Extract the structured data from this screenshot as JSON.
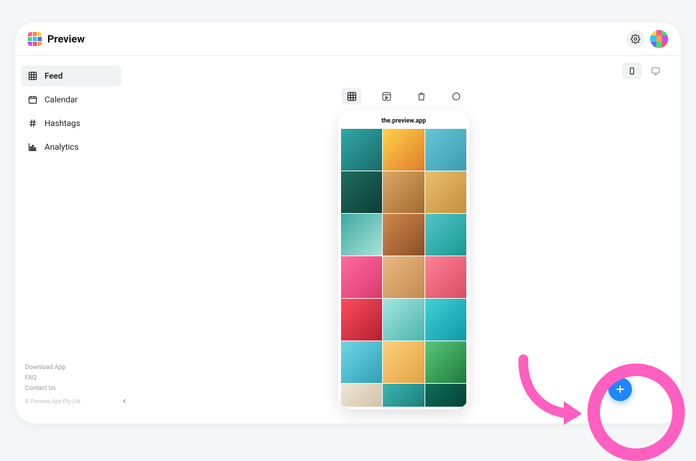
{
  "brand": {
    "title": "Preview"
  },
  "sidebar": {
    "items": [
      {
        "label": "Feed"
      },
      {
        "label": "Calendar"
      },
      {
        "label": "Hashtags"
      },
      {
        "label": "Analytics"
      }
    ],
    "footer": {
      "download": "Download App",
      "faq": "FAQ",
      "contact": "Contact Us",
      "copyright": "© Preview App Pty Ltd"
    }
  },
  "phone": {
    "username": "the.preview.app"
  }
}
